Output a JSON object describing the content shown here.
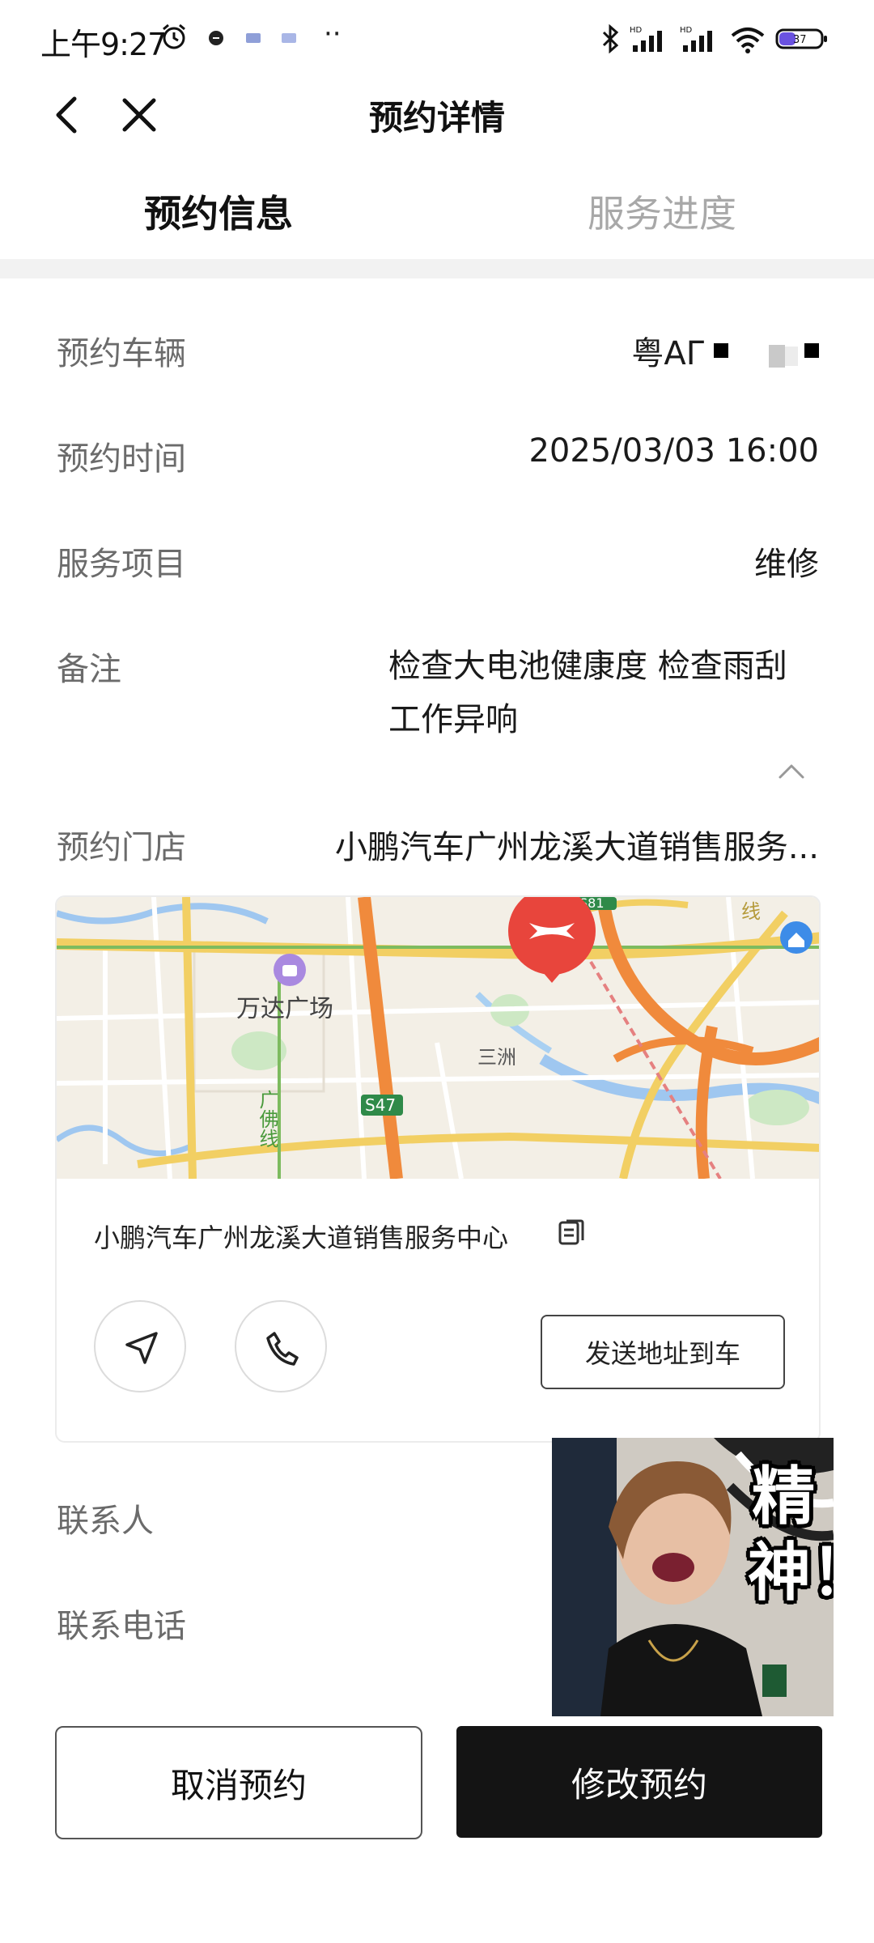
{
  "status_bar": {
    "time": "上午9:27",
    "dots": "··",
    "battery_level": "37"
  },
  "nav": {
    "title": "预约详情"
  },
  "tabs": [
    {
      "label": "预约信息",
      "active": true
    },
    {
      "label": "服务进度",
      "active": false
    }
  ],
  "info": {
    "vehicle": {
      "label": "预约车辆",
      "value": "粤AΓ"
    },
    "time": {
      "label": "预约时间",
      "value": "2025/03/03 16:00"
    },
    "service": {
      "label": "服务项目",
      "value": "维修"
    },
    "remark": {
      "label": "备注",
      "value": "检查大电池健康度 检查雨刮工作异响"
    },
    "store": {
      "label": "预约门店",
      "value": "小鹏汽车广州龙溪大道销售服务..."
    },
    "contact": {
      "label": "联系人"
    },
    "phone": {
      "label": "联系电话"
    }
  },
  "map": {
    "labels": {
      "wanda": "万达广场",
      "sanzhou": "三洲",
      "road_s47": "S47",
      "road_s81": "S81",
      "line_guangfo": "广佛线",
      "line_top": "线"
    }
  },
  "store_card": {
    "name": "小鹏汽车广州龙溪大道销售服务中心",
    "send_button": "发送地址到车"
  },
  "sticker": {
    "text": "精神！"
  },
  "actions": {
    "cancel": "取消预约",
    "modify": "修改预约"
  },
  "colors": {
    "primary_button": "#141414",
    "label_gray": "#6b6b6b",
    "tab_inactive": "#a8a8a8",
    "brand_red": "#e8453c"
  }
}
